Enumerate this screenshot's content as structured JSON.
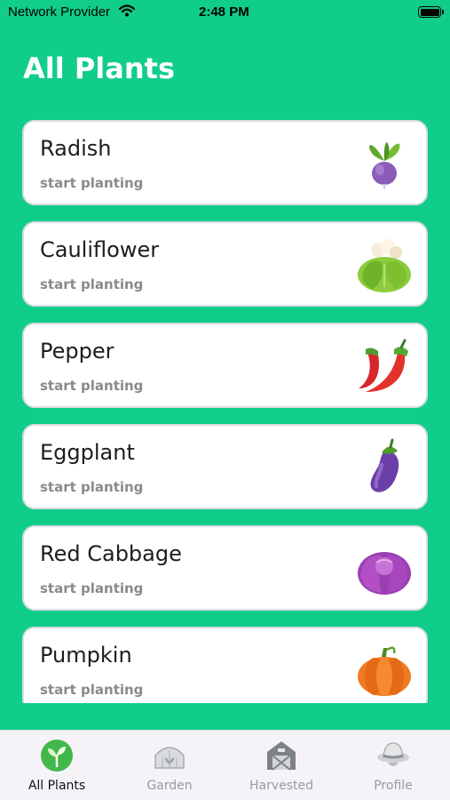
{
  "status": {
    "carrier": "Network Provider",
    "time": "2:48 PM"
  },
  "title": "All Plants",
  "plants": [
    {
      "name": "Radish",
      "status": "start planting",
      "icon": "radish-icon"
    },
    {
      "name": "Cauliflower",
      "status": "start planting",
      "icon": "cauliflower-icon"
    },
    {
      "name": "Pepper",
      "status": "start planting",
      "icon": "pepper-icon"
    },
    {
      "name": "Eggplant",
      "status": "start planting",
      "icon": "eggplant-icon"
    },
    {
      "name": "Red Cabbage",
      "status": "start planting",
      "icon": "red-cabbage-icon"
    },
    {
      "name": "Pumpkin",
      "status": "start planting",
      "icon": "pumpkin-icon"
    }
  ],
  "tabs": [
    {
      "label": "All Plants",
      "icon": "sprout-icon",
      "active": true
    },
    {
      "label": "Garden",
      "icon": "greenhouse-icon",
      "active": false
    },
    {
      "label": "Harvested",
      "icon": "barn-icon",
      "active": false
    },
    {
      "label": "Profile",
      "icon": "farmer-hat-icon",
      "active": false
    }
  ],
  "colors": {
    "background": "#11cd8a",
    "card": "#ffffff",
    "tabbar": "#f6f3f8"
  }
}
